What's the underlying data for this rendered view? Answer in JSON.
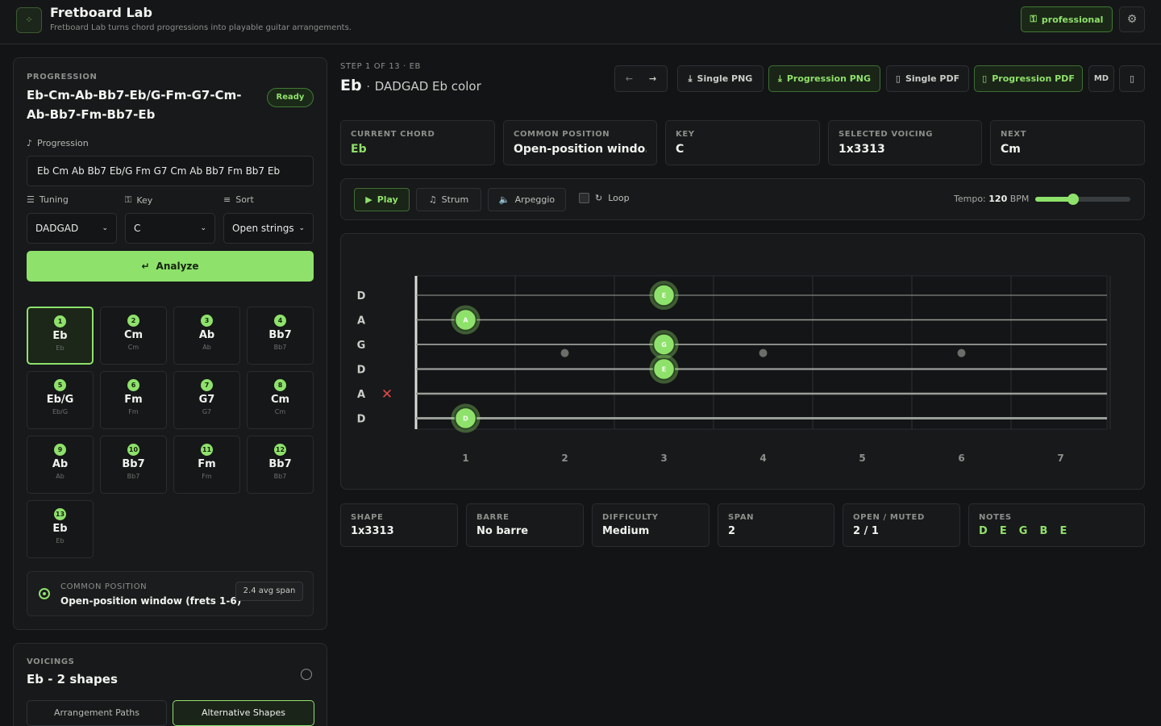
{
  "app": {
    "title": "Fretboard Lab",
    "subtitle": "Fretboard Lab turns chord progressions into playable guitar arrangements.",
    "plan_label": "professional"
  },
  "left": {
    "section_label": "PROGRESSION",
    "progression_title": "Eb-Cm-Ab-Bb7-Eb/G-Fm-G7-Cm-Ab-Bb7-Fm-Bb7-Eb",
    "status": "Ready",
    "progression_label": "Progression",
    "progression_value": "Eb Cm Ab Bb7 Eb/G Fm G7 Cm Ab Bb7 Fm Bb7 Eb",
    "tuning_label": "Tuning",
    "tuning_value": "DADGAD",
    "key_label": "Key",
    "key_value": "C",
    "sort_label": "Sort",
    "sort_value": "Open strings",
    "analyze_label": "Analyze",
    "chords": [
      {
        "n": "1",
        "name": "Eb",
        "sub": "Eb"
      },
      {
        "n": "2",
        "name": "Cm",
        "sub": "Cm"
      },
      {
        "n": "3",
        "name": "Ab",
        "sub": "Ab"
      },
      {
        "n": "4",
        "name": "Bb7",
        "sub": "Bb7"
      },
      {
        "n": "5",
        "name": "Eb/G",
        "sub": "Eb/G"
      },
      {
        "n": "6",
        "name": "Fm",
        "sub": "Fm"
      },
      {
        "n": "7",
        "name": "G7",
        "sub": "G7"
      },
      {
        "n": "8",
        "name": "Cm",
        "sub": "Cm"
      },
      {
        "n": "9",
        "name": "Ab",
        "sub": "Ab"
      },
      {
        "n": "10",
        "name": "Bb7",
        "sub": "Bb7"
      },
      {
        "n": "11",
        "name": "Fm",
        "sub": "Fm"
      },
      {
        "n": "12",
        "name": "Bb7",
        "sub": "Bb7"
      },
      {
        "n": "13",
        "name": "Eb",
        "sub": "Eb"
      }
    ],
    "common_label": "COMMON POSITION",
    "common_value": "Open-position window (frets 1-6)",
    "avg_span": "2.4 avg span",
    "voicings_label": "VOICINGS",
    "voicings_title": "Eb - 2 shapes",
    "tabs": [
      "Arrangement Paths",
      "Alternative Shapes"
    ]
  },
  "header": {
    "step": "STEP 1 OF 13 · EB",
    "chord": "Eb",
    "subtitle": "DADGAD Eb color",
    "buttons": {
      "single_png": "Single PNG",
      "prog_png": "Progression PNG",
      "single_pdf": "Single PDF",
      "prog_pdf": "Progression PDF",
      "md": "MD"
    }
  },
  "stats": [
    {
      "label": "CURRENT CHORD",
      "value": "Eb"
    },
    {
      "label": "COMMON POSITION",
      "value": "Open-position windo..."
    },
    {
      "label": "KEY",
      "value": "C"
    },
    {
      "label": "SELECTED VOICING",
      "value": "1x3313"
    },
    {
      "label": "NEXT",
      "value": "Cm"
    }
  ],
  "controls": {
    "play": "Play",
    "strum": "Strum",
    "arpeggio": "Arpeggio",
    "loop": "Loop",
    "tempo_label": "Tempo:",
    "tempo_value": "120",
    "tempo_unit": "BPM",
    "tempo_fraction": 0.4
  },
  "fretboard": {
    "strings": [
      "D",
      "A",
      "G",
      "D",
      "A",
      "D"
    ],
    "fret_numbers": [
      "1",
      "2",
      "3",
      "4",
      "5",
      "6",
      "7"
    ],
    "inlays": [
      2,
      4,
      6
    ],
    "notes": [
      {
        "string": 0,
        "fret": 3,
        "label": "E"
      },
      {
        "string": 1,
        "fret": 1,
        "label": "A"
      },
      {
        "string": 2,
        "fret": 3,
        "label": "G"
      },
      {
        "string": 3,
        "fret": 3,
        "label": "E"
      },
      {
        "string": 5,
        "fret": 1,
        "label": "D"
      }
    ],
    "muted_string": 4,
    "colors": {
      "note": "#8ee26b",
      "muted": "#e04848"
    }
  },
  "bottom_stats": [
    {
      "label": "SHAPE",
      "value": "1x3313"
    },
    {
      "label": "BARRE",
      "value": "No barre"
    },
    {
      "label": "DIFFICULTY",
      "value": "Medium"
    },
    {
      "label": "SPAN",
      "value": "2"
    },
    {
      "label": "OPEN / MUTED",
      "value": "2 / 1"
    },
    {
      "label": "NOTES",
      "value": "D  E  G  B  E"
    }
  ]
}
